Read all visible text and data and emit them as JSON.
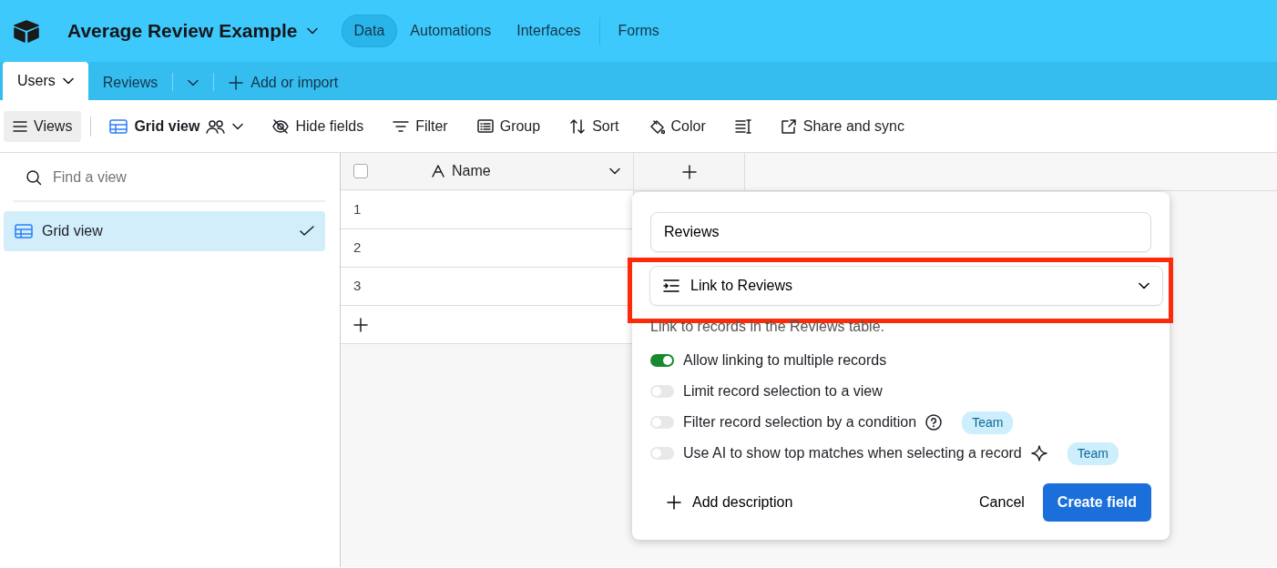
{
  "app": {
    "title": "Average Review Example"
  },
  "nav_tabs": [
    {
      "label": "Data",
      "selected": true
    },
    {
      "label": "Automations",
      "selected": false
    },
    {
      "label": "Interfaces",
      "selected": false
    },
    {
      "label": "Forms",
      "selected": false
    }
  ],
  "table_tabs": [
    {
      "label": "Users",
      "selected": true
    },
    {
      "label": "Reviews",
      "selected": false
    }
  ],
  "add_table": "Add or import",
  "toolbar": {
    "views": "Views",
    "view_name": "Grid view",
    "items": [
      {
        "kind": "hide",
        "label": "Hide fields"
      },
      {
        "kind": "filter",
        "label": "Filter"
      },
      {
        "kind": "group",
        "label": "Group"
      },
      {
        "kind": "sort",
        "label": "Sort"
      },
      {
        "kind": "color",
        "label": "Color"
      },
      {
        "kind": "height"
      },
      {
        "kind": "share",
        "label": "Share and sync"
      }
    ]
  },
  "sidebar": {
    "placeholder": "Find a view",
    "views": [
      {
        "label": "Grid view",
        "selected": true
      }
    ]
  },
  "grid": {
    "select_all_checked": false,
    "columns": [
      {
        "label": "Name"
      }
    ],
    "rows": [
      "1",
      "2",
      "3"
    ]
  },
  "popup": {
    "field_name": "Reviews",
    "field_type": "Link to Reviews",
    "highlighted": true,
    "description": "Link to records in the Reviews table.",
    "options": [
      {
        "kind": "plain",
        "label": "Allow linking to multiple records",
        "on": true
      },
      {
        "kind": "plain",
        "label": "Limit record selection to a view",
        "on": false
      },
      {
        "kind": "help",
        "label": "Filter record selection by a condition",
        "on": false,
        "badge": "Team"
      },
      {
        "kind": "ai",
        "label": "Use AI to show top matches when selecting a record",
        "on": false,
        "badge": "Team"
      }
    ],
    "add_description": "Add description",
    "cancel": "Cancel",
    "create": "Create field"
  }
}
